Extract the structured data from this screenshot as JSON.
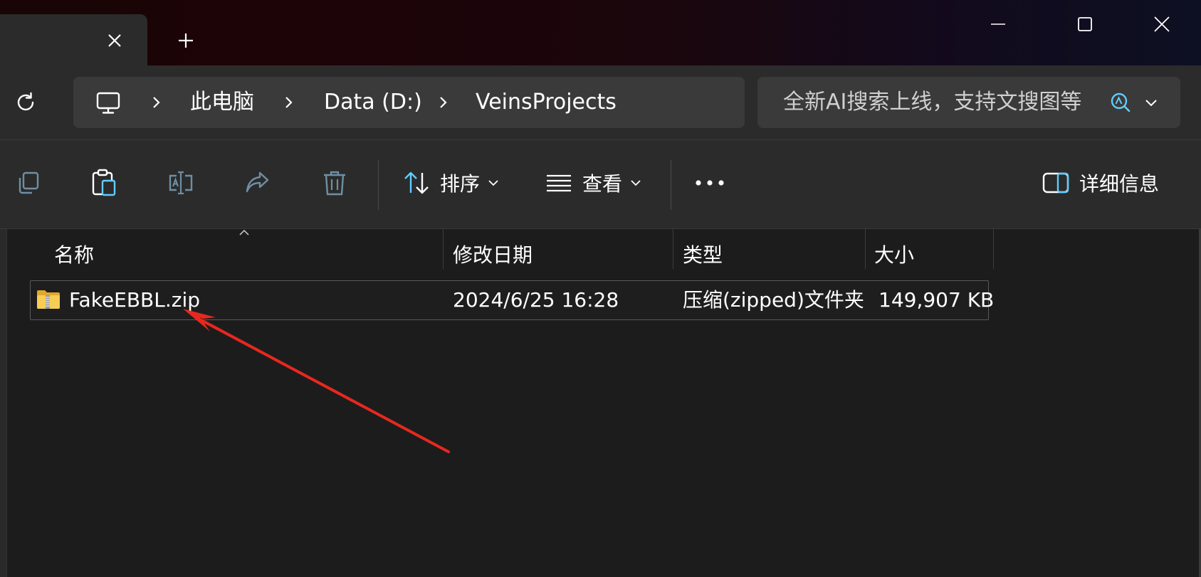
{
  "titlebar": {
    "tab_close": "close-icon",
    "new_tab": "plus-icon",
    "window_controls": [
      "minimize-icon",
      "maximize-icon",
      "close-icon"
    ]
  },
  "address": {
    "breadcrumbs": [
      "此电脑",
      "Data (D:)",
      "VeinsProjects"
    ]
  },
  "search": {
    "placeholder": "全新AI搜索上线，支持文搜图等"
  },
  "commands": {
    "sort_label": "排序",
    "view_label": "查看",
    "details_label": "详细信息"
  },
  "columns": {
    "name": "名称",
    "modified": "修改日期",
    "type": "类型",
    "size": "大小"
  },
  "files": [
    {
      "name": "FakeEBBL.zip",
      "modified": "2024/6/25 16:28",
      "type": "压缩(zipped)文件夹",
      "size": "149,907 KB"
    }
  ],
  "colors": {
    "background": "#1c1c1c",
    "toolbar": "#2b2b2b",
    "accent": "#60cdff",
    "annotation_arrow": "#e8281e"
  }
}
